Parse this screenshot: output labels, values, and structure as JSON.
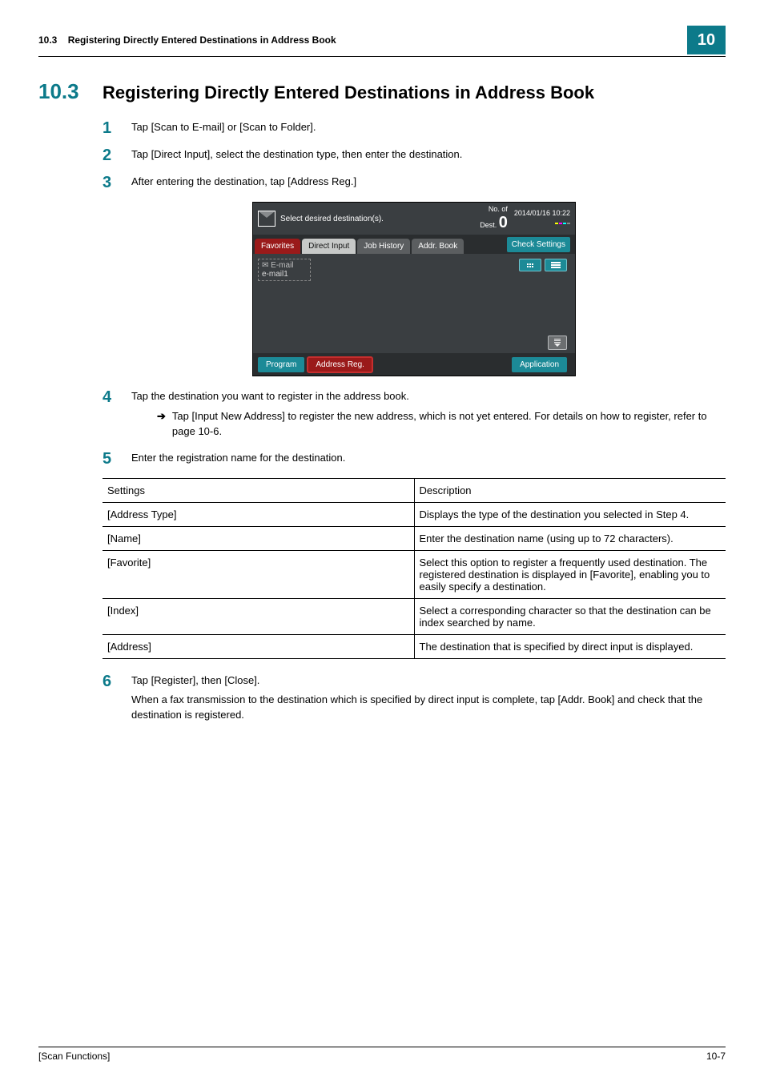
{
  "running_head": {
    "section": "10.3",
    "title": "Registering Directly Entered Destinations in Address Book",
    "badge": "10"
  },
  "heading": {
    "number": "10.3",
    "title": "Registering Directly Entered Destinations in Address Book"
  },
  "steps": {
    "s1": {
      "n": "1",
      "t": "Tap [Scan to E-mail] or [Scan to Folder]."
    },
    "s2": {
      "n": "2",
      "t": "Tap [Direct Input], select the destination type, then enter the destination."
    },
    "s3": {
      "n": "3",
      "t": "After entering the destination, tap [Address Reg.]"
    },
    "s4": {
      "n": "4",
      "t": "Tap the destination you want to register in the address book."
    },
    "s4_sub": "Tap [Input New Address] to register the new address, which is not yet entered. For details on how to register, refer to page 10-6.",
    "s5": {
      "n": "5",
      "t": "Enter the registration name for the destination."
    },
    "s6": {
      "n": "6",
      "t": "Tap [Register], then [Close]."
    },
    "s6_sub": "When a fax transmission to the destination which is specified by direct input is complete, tap [Addr. Book] and check that the destination is registered."
  },
  "screenshot": {
    "prompt": "Select desired destination(s).",
    "dest_label": "No. of\nDest.",
    "dest_count": "0",
    "datetime": "2014/01/16 10:22",
    "tabs": {
      "favorites": "Favorites",
      "direct_input": "Direct Input",
      "job_history": "Job History",
      "addr_book": "Addr. Book"
    },
    "check_settings": "Check Settings",
    "dest_chip_top": "E-mail",
    "dest_chip_bottom": "e-mail1",
    "bottom": {
      "program": "Program",
      "address_reg": "Address Reg.",
      "application": "Application"
    }
  },
  "table": {
    "head": {
      "settings": "Settings",
      "description": "Description"
    },
    "rows": [
      {
        "s": "[Address Type]",
        "d": "Displays the type of the destination you selected in Step 4."
      },
      {
        "s": "[Name]",
        "d": "Enter the destination name (using up to 72 characters)."
      },
      {
        "s": "[Favorite]",
        "d": "Select this option to register a frequently used destination. The registered destination is displayed in [Favorite], enabling you to easily specify a destination."
      },
      {
        "s": "[Index]",
        "d": "Select a corresponding character so that the destination can be index searched by name."
      },
      {
        "s": "[Address]",
        "d": "The destination that is specified by direct input is displayed."
      }
    ]
  },
  "footer": {
    "left": "[Scan Functions]",
    "right": "10-7"
  }
}
